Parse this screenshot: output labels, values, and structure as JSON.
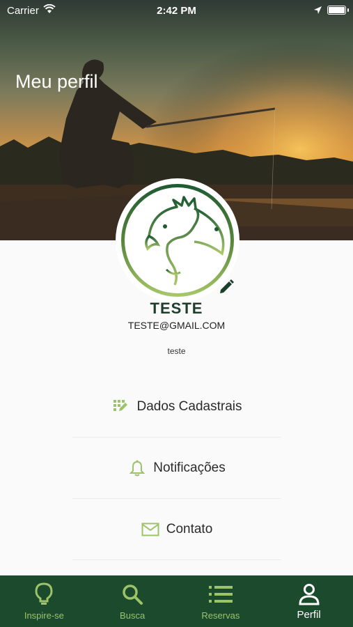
{
  "status_bar": {
    "carrier": "Carrier",
    "time": "2:42 PM"
  },
  "header": {
    "title": "Meu perfil"
  },
  "profile": {
    "name": "TESTE",
    "email": "TESTE@GMAIL.COM",
    "bio": "teste"
  },
  "menu": {
    "items": [
      {
        "label": "Dados Cadastrais",
        "icon": "form-grid-icon"
      },
      {
        "label": "Notificações",
        "icon": "bell-icon"
      },
      {
        "label": "Contato",
        "icon": "envelope-icon"
      }
    ]
  },
  "tabbar": {
    "items": [
      {
        "label": "Inspire-se",
        "icon": "lightbulb-icon",
        "active": false
      },
      {
        "label": "Busca",
        "icon": "search-icon",
        "active": false
      },
      {
        "label": "Reservas",
        "icon": "list-icon",
        "active": false
      },
      {
        "label": "Perfil",
        "icon": "user-icon",
        "active": true
      }
    ]
  },
  "colors": {
    "brand_dark_green": "#1c4a2c",
    "accent_light_green": "#9dc36a",
    "name_text": "#1f3d2b"
  }
}
